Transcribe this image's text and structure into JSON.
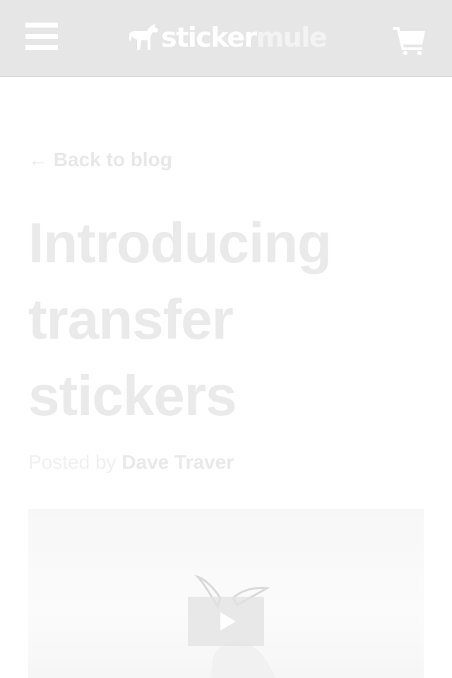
{
  "header": {
    "logo_text_primary": "sticker",
    "logo_text_secondary": "mule",
    "menu_icon": "hamburger-menu-icon",
    "cart_icon": "shopping-cart-icon",
    "background_color": "#e6e6e6"
  },
  "article": {
    "back_label": "← Back to blog",
    "title": "Introducing transfer stickers",
    "posted_by_label": "Posted by",
    "author": "Dave Traver"
  },
  "video": {
    "play_icon": "play-icon"
  }
}
